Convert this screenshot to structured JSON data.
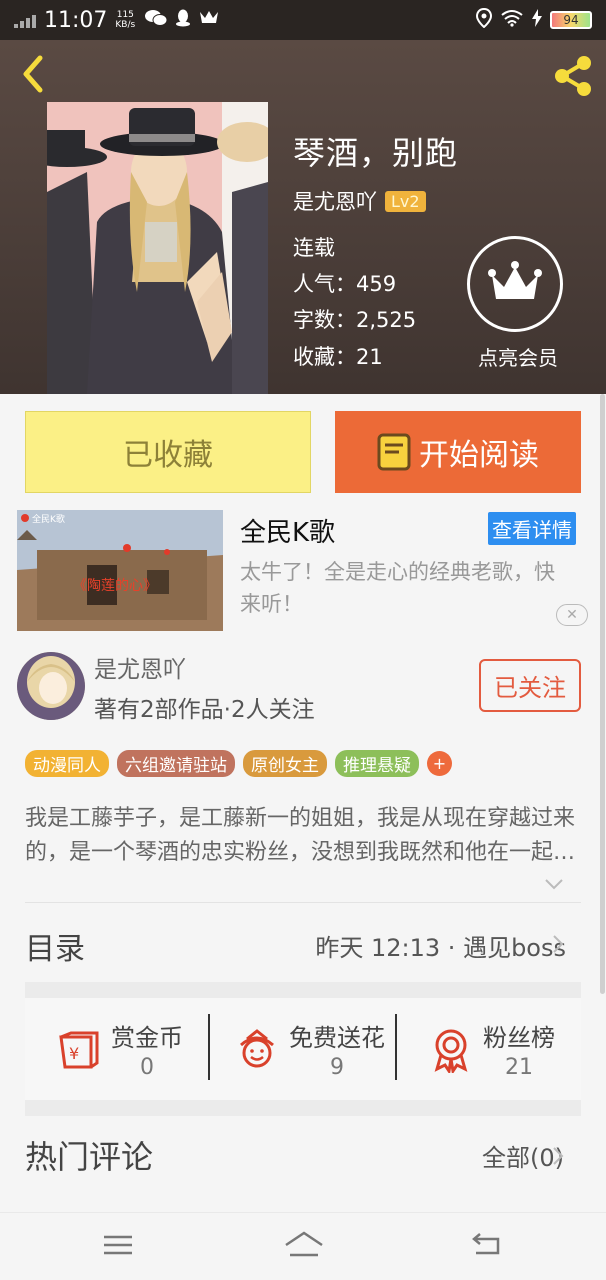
{
  "status_bar": {
    "time": "11:07",
    "net_speed_value": "115",
    "net_speed_unit": "KB/s",
    "battery_percent": "94"
  },
  "book": {
    "title": "琴酒，别跑",
    "author": "是尤恩吖",
    "level": "Lv2",
    "status": "连载",
    "popularity": "人气：459",
    "word_count": "字数：2,525",
    "favorites": "收藏：21",
    "vip_label": "点亮会员"
  },
  "actions": {
    "favorited_label": "已收藏",
    "read_label": "开始阅读"
  },
  "ad": {
    "title": "全民K歌",
    "detail_button": "查看详情",
    "description": "太牛了！全是走心的经典老歌，快来听！",
    "image_logo": "全民K歌",
    "image_caption": "《陶莲的心》",
    "close_symbol": "✕"
  },
  "author_card": {
    "name": "是尤恩吖",
    "works": "著有2部作品·2人关注",
    "follow_label": "已关注"
  },
  "tags": [
    {
      "label": "动漫同人",
      "color": "#f2b233"
    },
    {
      "label": "六组邀请驻站",
      "color": "#c0735e"
    },
    {
      "label": "原创女主",
      "color": "#d99a3d"
    },
    {
      "label": "推理悬疑",
      "color": "#8dbf5a"
    }
  ],
  "tag_more": "+",
  "intro": "我是工藤芋子，是工藤新一的姐姐，我是从现在穿越过来的，是一个琴酒的忠实粉丝，没想到我既然和他在一起…",
  "toc": {
    "label": "目录",
    "latest": "昨天 12:13 · 遇见boss"
  },
  "stats": [
    {
      "label": "赏金币",
      "value": "0",
      "icon": "red-envelope-icon"
    },
    {
      "label": "免费送花",
      "value": "9",
      "icon": "flower-icon"
    },
    {
      "label": "粉丝榜",
      "value": "21",
      "icon": "medal-icon"
    }
  ],
  "comments": {
    "label": "热门评论",
    "all_label": "全部(0)"
  },
  "colors": {
    "accent_orange": "#ec6a37",
    "favorite_yellow": "#fbf086",
    "follow_red": "#e35b3f",
    "ad_blue": "#2d8ef0",
    "icon_red": "#d9412b"
  }
}
